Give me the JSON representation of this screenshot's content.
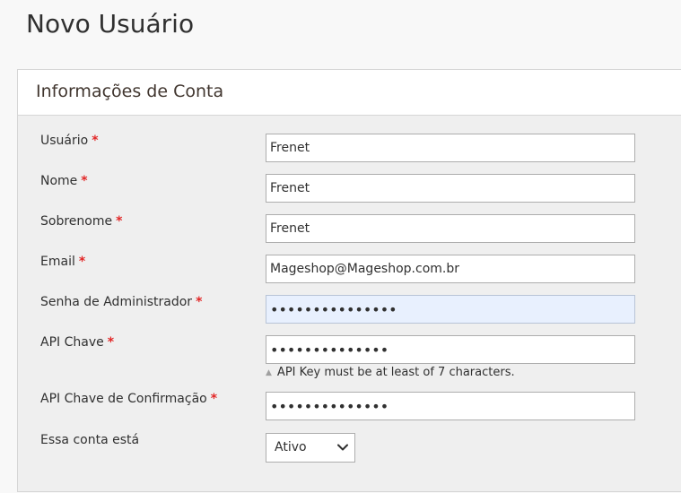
{
  "page": {
    "title": "Novo Usuário"
  },
  "section": {
    "title": "Informações de Conta"
  },
  "form": {
    "username": {
      "label": "Usuário",
      "required_mark": "*",
      "value": "Frenet"
    },
    "firstname": {
      "label": "Nome",
      "required_mark": "*",
      "value": "Frenet"
    },
    "lastname": {
      "label": "Sobrenome",
      "required_mark": "*",
      "value": "Frenet"
    },
    "email": {
      "label": "Email",
      "required_mark": "*",
      "value": "Mageshop@Mageshop.com.br"
    },
    "admin_password": {
      "label": "Senha de Administrador",
      "required_mark": "*",
      "value": "•••••••••••••••"
    },
    "api_key": {
      "label": "API Chave",
      "required_mark": "*",
      "value": "••••••••••••••",
      "note": "API Key must be at least of 7 characters."
    },
    "api_key_confirm": {
      "label": "API Chave de Confirmação",
      "required_mark": "*",
      "value": "••••••••••••••"
    },
    "account_status": {
      "label": "Essa conta está",
      "selected": "Ativo"
    }
  },
  "colors": {
    "required": "#e22626",
    "section_bg": "#efefef",
    "autofill_bg": "#e8f0fe"
  },
  "icons": {
    "note": "triangle-up-icon",
    "select": "chevron-down-icon"
  }
}
